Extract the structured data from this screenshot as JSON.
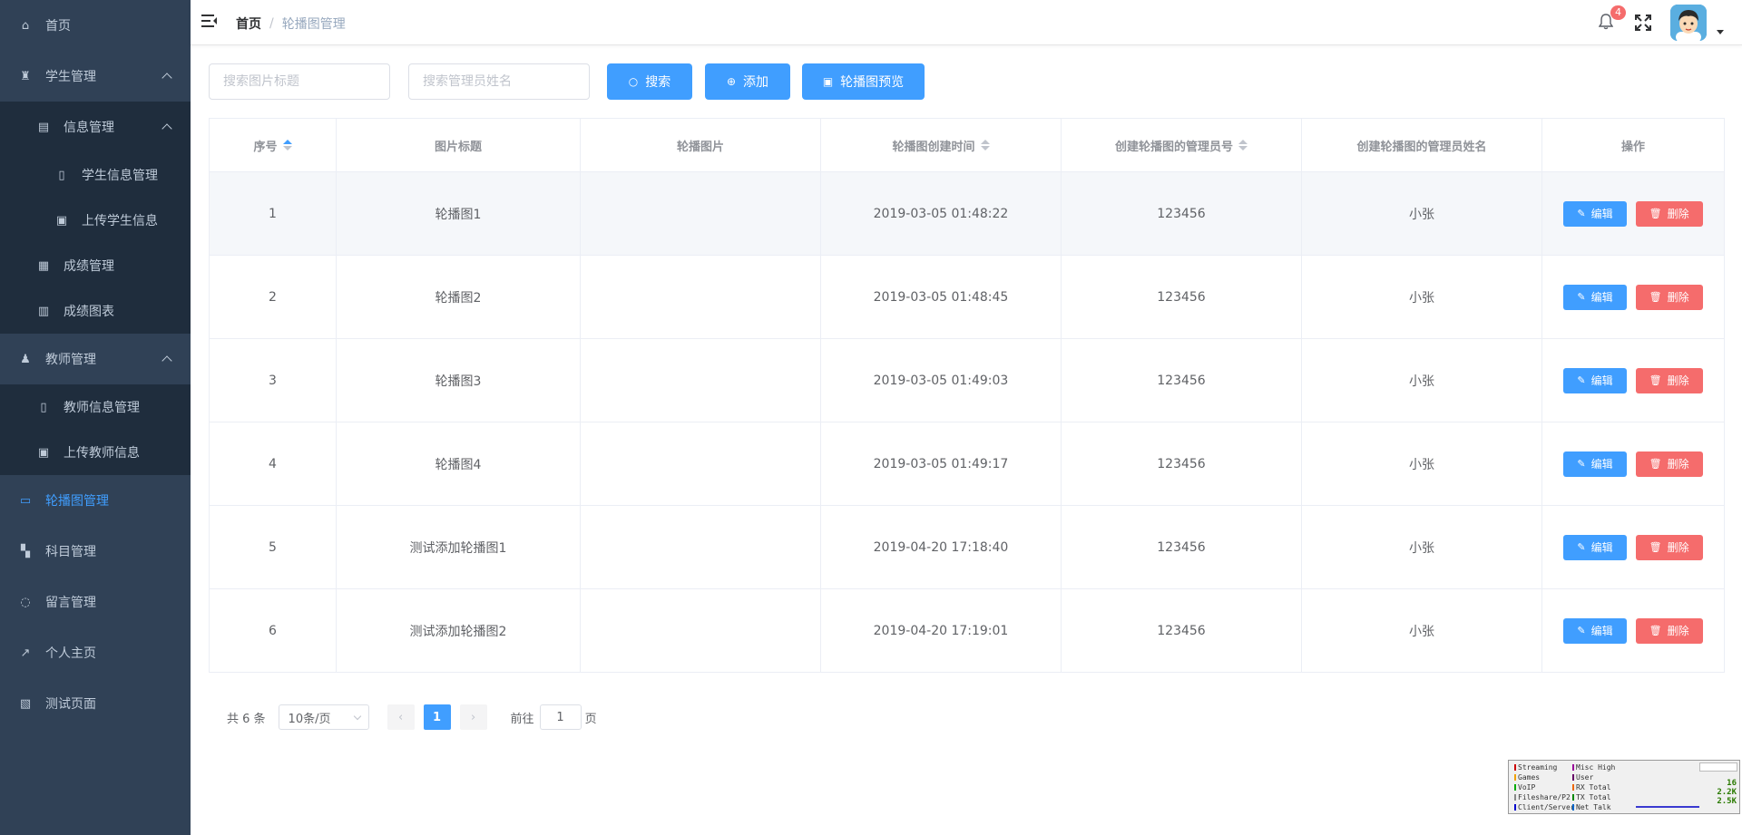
{
  "sidebar": {
    "items": [
      {
        "label": "首页",
        "icon": "home-icon"
      },
      {
        "label": "学生管理",
        "icon": "student-icon"
      },
      {
        "label": "信息管理",
        "icon": "document-icon"
      },
      {
        "label": "学生信息管理",
        "icon": "file-icon"
      },
      {
        "label": "上传学生信息",
        "icon": "excel-icon"
      },
      {
        "label": "成绩管理",
        "icon": "calendar-icon"
      },
      {
        "label": "成绩图表",
        "icon": "chart-icon"
      },
      {
        "label": "教师管理",
        "icon": "teacher-icon"
      },
      {
        "label": "教师信息管理",
        "icon": "file-icon"
      },
      {
        "label": "上传教师信息",
        "icon": "excel-icon"
      },
      {
        "label": "轮播图管理",
        "icon": "carousel-icon"
      },
      {
        "label": "科目管理",
        "icon": "subject-icon"
      },
      {
        "label": "留言管理",
        "icon": "message-icon"
      },
      {
        "label": "个人主页",
        "icon": "external-link-icon"
      },
      {
        "label": "测试页面",
        "icon": "test-icon"
      }
    ],
    "active": "轮播图管理",
    "colors": {
      "bg": "#304156",
      "submenu_bg": "#1f2d3d",
      "text": "#bfcbd9",
      "active": "#409eff"
    }
  },
  "header": {
    "breadcrumb_home": "首页",
    "breadcrumb_sep": "/",
    "breadcrumb_current": "轮播图管理",
    "notification_count": "4"
  },
  "toolbar": {
    "search_title_placeholder": "搜索图片标题",
    "search_admin_placeholder": "搜索管理员姓名",
    "search_label": "搜索",
    "add_label": "添加",
    "preview_label": "轮播图预览"
  },
  "table": {
    "columns": [
      "序号",
      "图片标题",
      "轮播图片",
      "轮播图创建时间",
      "创建轮播图的管理员号",
      "创建轮播图的管理员姓名",
      "操作"
    ],
    "edit_label": "编辑",
    "delete_label": "删除",
    "rows": [
      {
        "index": "1",
        "title": "轮播图1",
        "image": "",
        "created": "2019-03-05 01:48:22",
        "admin_id": "123456",
        "admin_name": "小张"
      },
      {
        "index": "2",
        "title": "轮播图2",
        "image": "",
        "created": "2019-03-05 01:48:45",
        "admin_id": "123456",
        "admin_name": "小张"
      },
      {
        "index": "3",
        "title": "轮播图3",
        "image": "",
        "created": "2019-03-05 01:49:03",
        "admin_id": "123456",
        "admin_name": "小张"
      },
      {
        "index": "4",
        "title": "轮播图4",
        "image": "",
        "created": "2019-03-05 01:49:17",
        "admin_id": "123456",
        "admin_name": "小张"
      },
      {
        "index": "5",
        "title": "测试添加轮播图1",
        "image": "",
        "created": "2019-04-20 17:18:40",
        "admin_id": "123456",
        "admin_name": "小张"
      },
      {
        "index": "6",
        "title": "测试添加轮播图2",
        "image": "",
        "created": "2019-04-20 17:19:01",
        "admin_id": "123456",
        "admin_name": "小张"
      }
    ]
  },
  "pagination": {
    "total": "共 6 条",
    "page_size": "10条/页",
    "current_page": "1",
    "goto_prefix": "前往",
    "goto_value": "1",
    "goto_suffix": "页"
  },
  "widget": {
    "legend": [
      "Streaming",
      "Games",
      "VoIP",
      "Fileshare/P2",
      "Client/Server",
      "Misc High",
      "User",
      "RX Total",
      "TX Total",
      "Net Talk"
    ],
    "values": [
      "16",
      "2.2K",
      "2.5K"
    ]
  },
  "colors": {
    "primary": "#409eff",
    "danger": "#f56c6c",
    "badge": "#f56c6c"
  }
}
